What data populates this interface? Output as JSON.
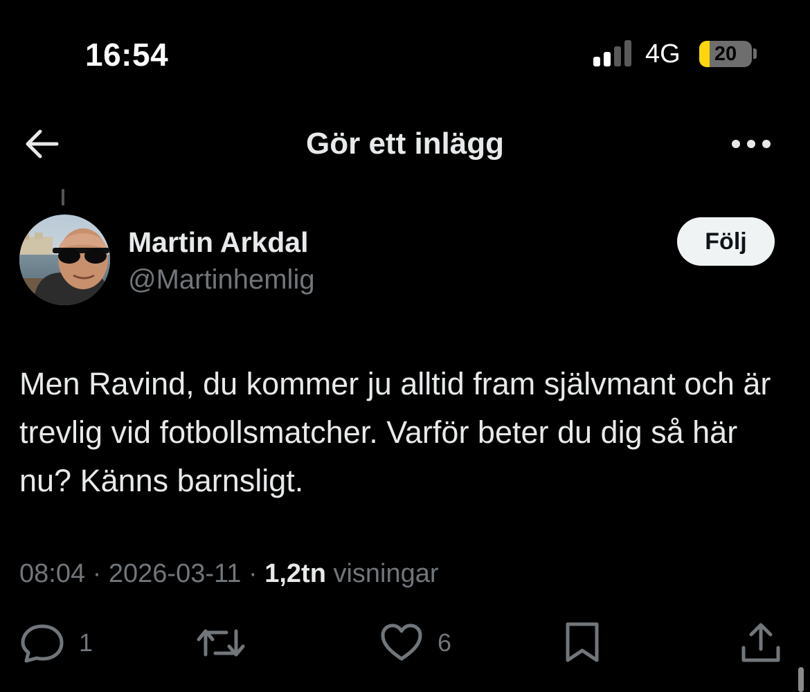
{
  "status_bar": {
    "time": "16:54",
    "network": "4G",
    "signal_bars_filled": 2,
    "signal_bars_total": 4,
    "battery_level": "20",
    "battery_fraction": 0.2
  },
  "header": {
    "title": "Gör ett inlägg",
    "back_icon": "arrow-left-icon",
    "more_icon": "more-horizontal-icon"
  },
  "author": {
    "name": "Martin Arkdal",
    "handle": "@Martinhemlig",
    "follow_label": "Följ"
  },
  "post": {
    "text": "Men Ravind, du kommer ju alltid fram självmant och är trevlig vid fotbollsmatcher. Varför beter du dig så här nu? Känns barnsligt."
  },
  "meta": {
    "time": "08:04",
    "separator": " · ",
    "date": "2026-03-11",
    "views_count": "1,2tn",
    "views_label": "visningar"
  },
  "actions": {
    "replies": "1",
    "likes": "6"
  },
  "colors": {
    "background": "#000000",
    "text": "#e7e9ea",
    "secondary": "#71767b",
    "battery_fill": "#ffd60a",
    "follow_bg": "#eff3f4"
  }
}
